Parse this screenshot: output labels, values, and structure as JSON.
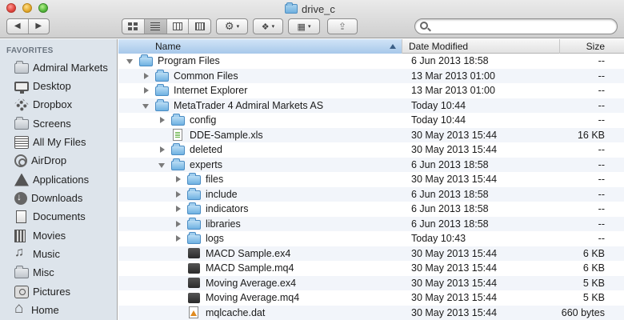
{
  "window": {
    "title": "drive_c",
    "title_icon": "folder-icon"
  },
  "toolbar": {
    "back": "◀",
    "forward": "▶",
    "caret": "▾",
    "view_modes": [
      {
        "name": "icon-view",
        "active": false
      },
      {
        "name": "list-view",
        "active": true
      },
      {
        "name": "column-view",
        "active": false
      },
      {
        "name": "cover-flow-view",
        "active": false
      }
    ],
    "action_icon": "gear-icon",
    "dropbox_icon": "dropbox-icon",
    "arrange_icon": "arrange-icon",
    "share_icon": "share-icon"
  },
  "search": {
    "value": "",
    "placeholder": ""
  },
  "sidebar": {
    "header": "FAVORITES",
    "items": [
      {
        "label": "Admiral Markets",
        "icon": "folder-icon"
      },
      {
        "label": "Desktop",
        "icon": "desktop-icon"
      },
      {
        "label": "Dropbox",
        "icon": "dropbox-icon"
      },
      {
        "label": "Screens",
        "icon": "folder-icon"
      },
      {
        "label": "All My Files",
        "icon": "all-files-icon"
      },
      {
        "label": "AirDrop",
        "icon": "airdrop-icon"
      },
      {
        "label": "Applications",
        "icon": "applications-icon"
      },
      {
        "label": "Downloads",
        "icon": "downloads-icon"
      },
      {
        "label": "Documents",
        "icon": "documents-icon"
      },
      {
        "label": "Movies",
        "icon": "movies-icon"
      },
      {
        "label": "Music",
        "icon": "music-icon"
      },
      {
        "label": "Misc",
        "icon": "folder-icon"
      },
      {
        "label": "Pictures",
        "icon": "pictures-icon"
      },
      {
        "label": "Home",
        "icon": "home-icon"
      }
    ]
  },
  "columns": {
    "name": "Name",
    "date": "Date Modified",
    "size": "Size"
  },
  "files": [
    {
      "name": "Program Files",
      "date": "6 Jun 2013 18:58",
      "size": "--",
      "depth": 0,
      "kind": "folder",
      "expanded": true
    },
    {
      "name": "Common Files",
      "date": "13 Mar 2013 01:00",
      "size": "--",
      "depth": 1,
      "kind": "folder",
      "expanded": false
    },
    {
      "name": "Internet Explorer",
      "date": "13 Mar 2013 01:00",
      "size": "--",
      "depth": 1,
      "kind": "folder",
      "expanded": false
    },
    {
      "name": "MetaTrader 4 Admiral Markets AS",
      "date": "Today 10:44",
      "size": "--",
      "depth": 1,
      "kind": "folder",
      "expanded": true
    },
    {
      "name": "config",
      "date": "Today 10:44",
      "size": "--",
      "depth": 2,
      "kind": "folder",
      "expanded": false
    },
    {
      "name": "DDE-Sample.xls",
      "date": "30 May 2013 15:44",
      "size": "16 KB",
      "depth": 2,
      "kind": "xls"
    },
    {
      "name": "deleted",
      "date": "30 May 2013 15:44",
      "size": "--",
      "depth": 2,
      "kind": "folder",
      "expanded": false
    },
    {
      "name": "experts",
      "date": "6 Jun 2013 18:58",
      "size": "--",
      "depth": 2,
      "kind": "folder",
      "expanded": true
    },
    {
      "name": "files",
      "date": "30 May 2013 15:44",
      "size": "--",
      "depth": 3,
      "kind": "folder",
      "expanded": false
    },
    {
      "name": "include",
      "date": "6 Jun 2013 18:58",
      "size": "--",
      "depth": 3,
      "kind": "folder",
      "expanded": false
    },
    {
      "name": "indicators",
      "date": "6 Jun 2013 18:58",
      "size": "--",
      "depth": 3,
      "kind": "folder",
      "expanded": false
    },
    {
      "name": "libraries",
      "date": "6 Jun 2013 18:58",
      "size": "--",
      "depth": 3,
      "kind": "folder",
      "expanded": false
    },
    {
      "name": "logs",
      "date": "Today 10:43",
      "size": "--",
      "depth": 3,
      "kind": "folder",
      "expanded": false
    },
    {
      "name": "MACD Sample.ex4",
      "date": "30 May 2013 15:44",
      "size": "6 KB",
      "depth": 3,
      "kind": "bin"
    },
    {
      "name": "MACD Sample.mq4",
      "date": "30 May 2013 15:44",
      "size": "6 KB",
      "depth": 3,
      "kind": "bin"
    },
    {
      "name": "Moving Average.ex4",
      "date": "30 May 2013 15:44",
      "size": "5 KB",
      "depth": 3,
      "kind": "bin"
    },
    {
      "name": "Moving Average.mq4",
      "date": "30 May 2013 15:44",
      "size": "5 KB",
      "depth": 3,
      "kind": "bin"
    },
    {
      "name": "mqlcache.dat",
      "date": "30 May 2013 15:44",
      "size": "660 bytes",
      "depth": 3,
      "kind": "dat"
    }
  ]
}
